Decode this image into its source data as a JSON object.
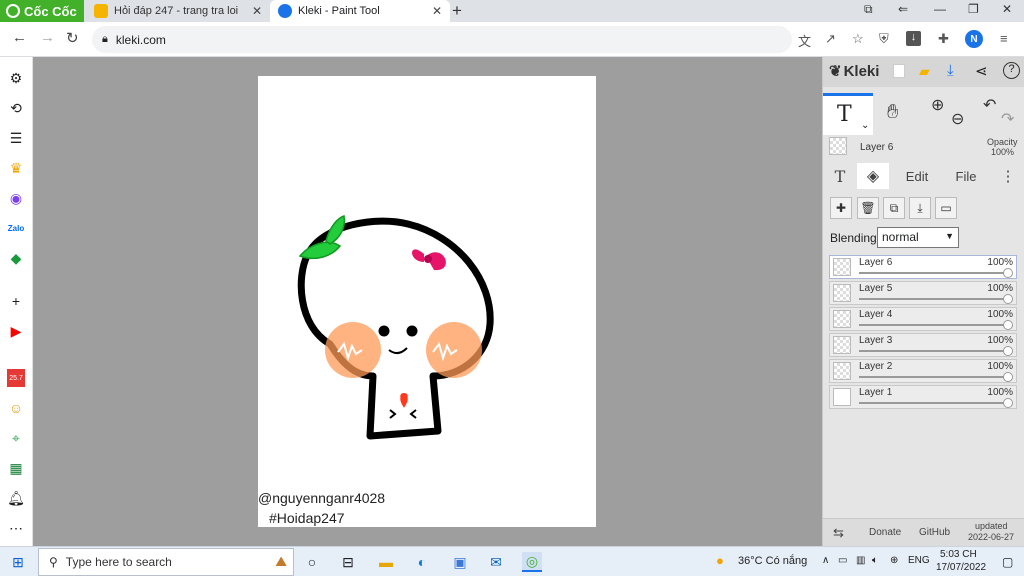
{
  "browser": {
    "brand": "Cốc Cốc",
    "tabs": [
      {
        "title": "Hỏi đáp 247 - trang tra loi",
        "active": false
      },
      {
        "title": "Kleki - Paint Tool",
        "active": true
      }
    ],
    "url": "kleki.com",
    "profile_initial": "N"
  },
  "sidebar": {
    "icons": [
      "gear-icon",
      "history-icon",
      "list-icon",
      "crown-icon",
      "messenger-icon",
      "zalo-icon",
      "game-icon",
      "add-icon",
      "youtube-icon",
      "calendar-icon",
      "sticker-icon",
      "map-icon",
      "sheet-icon",
      "bell-icon",
      "more-icon"
    ],
    "calendar_text": "25.7"
  },
  "canvas": {
    "watermark_line1": "@nguyennganr4028",
    "watermark_line2": "#Hoidap247"
  },
  "kleki": {
    "app_name": "Kleki",
    "tool_letter": "T",
    "current_layer": "Layer 6",
    "opacity_label": "Opacity",
    "opacity_value": "100%",
    "tabs": [
      "T",
      "Edit",
      "File"
    ],
    "blending_label": "Blending",
    "blending_value": "normal",
    "layers": [
      {
        "name": "Layer 6",
        "opacity": "100%",
        "selected": true
      },
      {
        "name": "Layer 5",
        "opacity": "100%",
        "selected": false
      },
      {
        "name": "Layer 4",
        "opacity": "100%",
        "selected": false
      },
      {
        "name": "Layer 3",
        "opacity": "100%",
        "selected": false
      },
      {
        "name": "Layer 2",
        "opacity": "100%",
        "selected": false
      },
      {
        "name": "Layer 1",
        "opacity": "100%",
        "selected": false
      }
    ],
    "footer": {
      "donate": "Donate",
      "github": "GitHub",
      "updated_label": "updated",
      "updated_date": "2022-06-27"
    }
  },
  "taskbar": {
    "search_placeholder": "Type here to search",
    "weather": "36°C  Có nắng",
    "language": "ENG",
    "time": "5:03 CH",
    "date": "17/07/2022"
  },
  "colors": {
    "brand_green": "#43b02a",
    "accent_blue": "#1a73e8",
    "canvas_gray": "#9e9e9e"
  }
}
